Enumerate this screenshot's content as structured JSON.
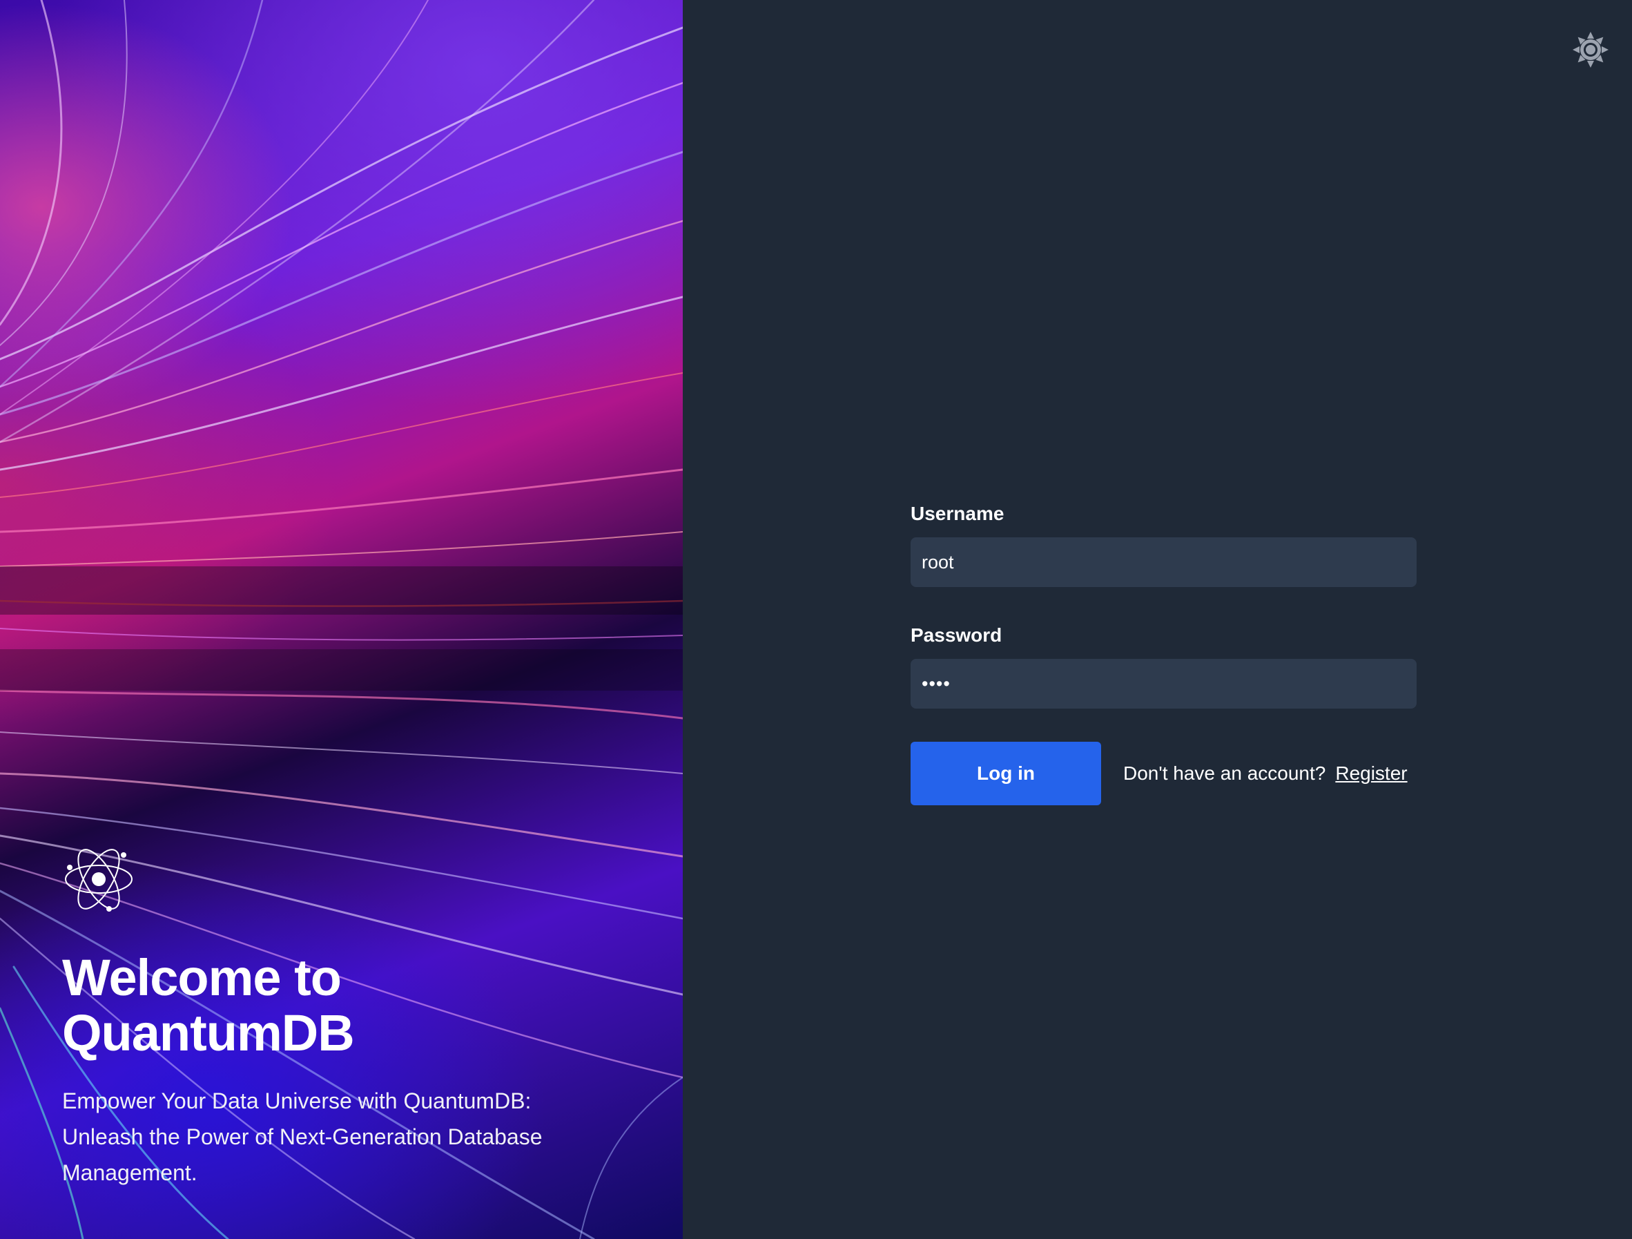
{
  "hero": {
    "title": "Welcome to QuantumDB",
    "subtitle": "Empower Your Data Universe with QuantumDB: Unleash the Power of Next-Generation Database Management.",
    "logo_icon": "atom-icon"
  },
  "header": {
    "theme_toggle_icon": "sun-icon"
  },
  "login": {
    "username_label": "Username",
    "username_value": "root",
    "password_label": "Password",
    "password_value": "••••",
    "login_button": "Log in",
    "register_prompt": "Don't have an account?",
    "register_link": "Register"
  },
  "colors": {
    "panel_bg": "#1f2937",
    "input_bg": "#2e3b4e",
    "accent": "#2563eb"
  }
}
